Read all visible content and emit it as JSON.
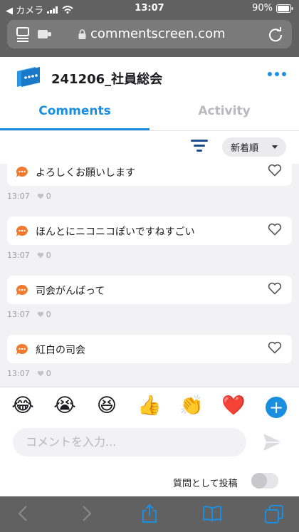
{
  "status_bar": {
    "carrier": "◀ カメラ",
    "time": "13:07",
    "battery": "90%"
  },
  "browser": {
    "url": "commentscreen.com"
  },
  "app": {
    "event_title": "241206_社員総会"
  },
  "tabs": [
    {
      "label": "Comments",
      "active": true
    },
    {
      "label": "Activity",
      "active": false
    }
  ],
  "sort": {
    "selected": "新着順"
  },
  "comments": [
    {
      "text": "よろしくお願いします",
      "time": "13:07",
      "likes": "0"
    },
    {
      "text": "ほんとにニコニコぽいですねすごい",
      "time": "13:07",
      "likes": "0"
    },
    {
      "text": "司会がんばって",
      "time": "13:07",
      "likes": "0"
    },
    {
      "text": "紅白の司会",
      "time": "13:07",
      "likes": "0"
    }
  ],
  "reactions": [
    {
      "icon": "laughing-tears-emoji",
      "glyph": "😂"
    },
    {
      "icon": "crying-emoji",
      "glyph": "😭"
    },
    {
      "icon": "grinning-squint-emoji",
      "glyph": "😆"
    },
    {
      "icon": "thumbs-up-emoji",
      "glyph": "👍"
    },
    {
      "icon": "clapping-hands-emoji",
      "glyph": "👏"
    },
    {
      "icon": "red-heart-emoji",
      "glyph": "❤️"
    }
  ],
  "compose": {
    "placeholder": "コメントを入力...",
    "question_label": "質問として投稿"
  },
  "colors": {
    "accent": "#1a8fe0",
    "comment_bubble": "#f07a2f",
    "chrome": "#616161"
  }
}
